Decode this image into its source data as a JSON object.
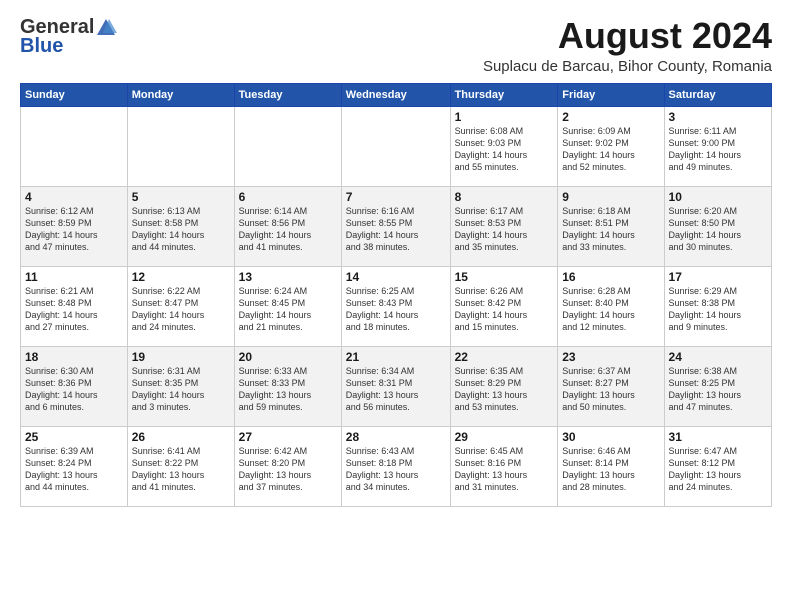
{
  "logo": {
    "general": "General",
    "blue": "Blue"
  },
  "title": {
    "month_year": "August 2024",
    "location": "Suplacu de Barcau, Bihor County, Romania"
  },
  "headers": [
    "Sunday",
    "Monday",
    "Tuesday",
    "Wednesday",
    "Thursday",
    "Friday",
    "Saturday"
  ],
  "weeks": [
    [
      {
        "day": "",
        "info": ""
      },
      {
        "day": "",
        "info": ""
      },
      {
        "day": "",
        "info": ""
      },
      {
        "day": "",
        "info": ""
      },
      {
        "day": "1",
        "info": "Sunrise: 6:08 AM\nSunset: 9:03 PM\nDaylight: 14 hours\nand 55 minutes."
      },
      {
        "day": "2",
        "info": "Sunrise: 6:09 AM\nSunset: 9:02 PM\nDaylight: 14 hours\nand 52 minutes."
      },
      {
        "day": "3",
        "info": "Sunrise: 6:11 AM\nSunset: 9:00 PM\nDaylight: 14 hours\nand 49 minutes."
      }
    ],
    [
      {
        "day": "4",
        "info": "Sunrise: 6:12 AM\nSunset: 8:59 PM\nDaylight: 14 hours\nand 47 minutes."
      },
      {
        "day": "5",
        "info": "Sunrise: 6:13 AM\nSunset: 8:58 PM\nDaylight: 14 hours\nand 44 minutes."
      },
      {
        "day": "6",
        "info": "Sunrise: 6:14 AM\nSunset: 8:56 PM\nDaylight: 14 hours\nand 41 minutes."
      },
      {
        "day": "7",
        "info": "Sunrise: 6:16 AM\nSunset: 8:55 PM\nDaylight: 14 hours\nand 38 minutes."
      },
      {
        "day": "8",
        "info": "Sunrise: 6:17 AM\nSunset: 8:53 PM\nDaylight: 14 hours\nand 35 minutes."
      },
      {
        "day": "9",
        "info": "Sunrise: 6:18 AM\nSunset: 8:51 PM\nDaylight: 14 hours\nand 33 minutes."
      },
      {
        "day": "10",
        "info": "Sunrise: 6:20 AM\nSunset: 8:50 PM\nDaylight: 14 hours\nand 30 minutes."
      }
    ],
    [
      {
        "day": "11",
        "info": "Sunrise: 6:21 AM\nSunset: 8:48 PM\nDaylight: 14 hours\nand 27 minutes."
      },
      {
        "day": "12",
        "info": "Sunrise: 6:22 AM\nSunset: 8:47 PM\nDaylight: 14 hours\nand 24 minutes."
      },
      {
        "day": "13",
        "info": "Sunrise: 6:24 AM\nSunset: 8:45 PM\nDaylight: 14 hours\nand 21 minutes."
      },
      {
        "day": "14",
        "info": "Sunrise: 6:25 AM\nSunset: 8:43 PM\nDaylight: 14 hours\nand 18 minutes."
      },
      {
        "day": "15",
        "info": "Sunrise: 6:26 AM\nSunset: 8:42 PM\nDaylight: 14 hours\nand 15 minutes."
      },
      {
        "day": "16",
        "info": "Sunrise: 6:28 AM\nSunset: 8:40 PM\nDaylight: 14 hours\nand 12 minutes."
      },
      {
        "day": "17",
        "info": "Sunrise: 6:29 AM\nSunset: 8:38 PM\nDaylight: 14 hours\nand 9 minutes."
      }
    ],
    [
      {
        "day": "18",
        "info": "Sunrise: 6:30 AM\nSunset: 8:36 PM\nDaylight: 14 hours\nand 6 minutes."
      },
      {
        "day": "19",
        "info": "Sunrise: 6:31 AM\nSunset: 8:35 PM\nDaylight: 14 hours\nand 3 minutes."
      },
      {
        "day": "20",
        "info": "Sunrise: 6:33 AM\nSunset: 8:33 PM\nDaylight: 13 hours\nand 59 minutes."
      },
      {
        "day": "21",
        "info": "Sunrise: 6:34 AM\nSunset: 8:31 PM\nDaylight: 13 hours\nand 56 minutes."
      },
      {
        "day": "22",
        "info": "Sunrise: 6:35 AM\nSunset: 8:29 PM\nDaylight: 13 hours\nand 53 minutes."
      },
      {
        "day": "23",
        "info": "Sunrise: 6:37 AM\nSunset: 8:27 PM\nDaylight: 13 hours\nand 50 minutes."
      },
      {
        "day": "24",
        "info": "Sunrise: 6:38 AM\nSunset: 8:25 PM\nDaylight: 13 hours\nand 47 minutes."
      }
    ],
    [
      {
        "day": "25",
        "info": "Sunrise: 6:39 AM\nSunset: 8:24 PM\nDaylight: 13 hours\nand 44 minutes."
      },
      {
        "day": "26",
        "info": "Sunrise: 6:41 AM\nSunset: 8:22 PM\nDaylight: 13 hours\nand 41 minutes."
      },
      {
        "day": "27",
        "info": "Sunrise: 6:42 AM\nSunset: 8:20 PM\nDaylight: 13 hours\nand 37 minutes."
      },
      {
        "day": "28",
        "info": "Sunrise: 6:43 AM\nSunset: 8:18 PM\nDaylight: 13 hours\nand 34 minutes."
      },
      {
        "day": "29",
        "info": "Sunrise: 6:45 AM\nSunset: 8:16 PM\nDaylight: 13 hours\nand 31 minutes."
      },
      {
        "day": "30",
        "info": "Sunrise: 6:46 AM\nSunset: 8:14 PM\nDaylight: 13 hours\nand 28 minutes."
      },
      {
        "day": "31",
        "info": "Sunrise: 6:47 AM\nSunset: 8:12 PM\nDaylight: 13 hours\nand 24 minutes."
      }
    ]
  ]
}
